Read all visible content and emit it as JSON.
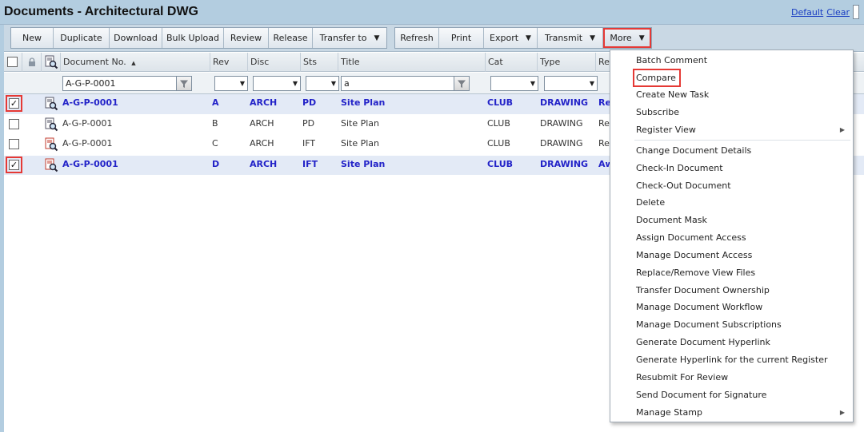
{
  "page": {
    "title": "Documents - Architectural DWG"
  },
  "top_links": {
    "default": "Default",
    "clear": "Clear"
  },
  "toolbar": {
    "group1": [
      "New",
      "Duplicate",
      "Download",
      "Bulk Upload",
      "Review",
      "Release",
      "Transfer to"
    ],
    "group2": [
      "Refresh",
      "Print",
      "Export",
      "Transmit"
    ],
    "more": "More"
  },
  "columns": {
    "doc_no": "Document No.",
    "rev": "Rev",
    "disc": "Disc",
    "sts": "Sts",
    "title": "Title",
    "cat": "Cat",
    "type": "Type",
    "re": "Re"
  },
  "filters": {
    "doc_no": "A-G-P-0001",
    "title": "a"
  },
  "rows": [
    {
      "checked": true,
      "doc_no": "A-G-P-0001",
      "rev": "A",
      "disc": "ARCH",
      "sts": "PD",
      "title": "Site Plan",
      "cat": "CLUB",
      "type": "DRAWING",
      "re": "Re"
    },
    {
      "checked": false,
      "doc_no": "A-G-P-0001",
      "rev": "B",
      "disc": "ARCH",
      "sts": "PD",
      "title": "Site Plan",
      "cat": "CLUB",
      "type": "DRAWING",
      "re": "Re"
    },
    {
      "checked": false,
      "doc_no": "A-G-P-0001",
      "rev": "C",
      "disc": "ARCH",
      "sts": "IFT",
      "title": "Site Plan",
      "cat": "CLUB",
      "type": "DRAWING",
      "re": "Re"
    },
    {
      "checked": true,
      "doc_no": "A-G-P-0001",
      "rev": "D",
      "disc": "ARCH",
      "sts": "IFT",
      "title": "Site Plan",
      "cat": "CLUB",
      "type": "DRAWING",
      "re": "Aw"
    }
  ],
  "menu": {
    "items": [
      "Batch Comment",
      "Compare",
      "Create New Task",
      "Subscribe",
      "Register View",
      "Change Document Details",
      "Check-In Document",
      "Check-Out Document",
      "Delete",
      "Document Mask",
      "Assign Document Access",
      "Manage Document Access",
      "Replace/Remove View Files",
      "Transfer Document Ownership",
      "Manage Document Workflow",
      "Manage Document Subscriptions",
      "Generate Document Hyperlink",
      "Generate Hyperlink for the current Register",
      "Resubmit For Review",
      "Send Document for Signature",
      "Manage Stamp"
    ]
  },
  "icons": {
    "check": "✓",
    "caret": "▼",
    "sort_asc": "▲",
    "submenu": "▶"
  },
  "colors": {
    "header_band": "#b3cde0",
    "selected_row": "#e3eaf6",
    "link_blue": "#2323c8",
    "highlight_red": "#e53935"
  }
}
